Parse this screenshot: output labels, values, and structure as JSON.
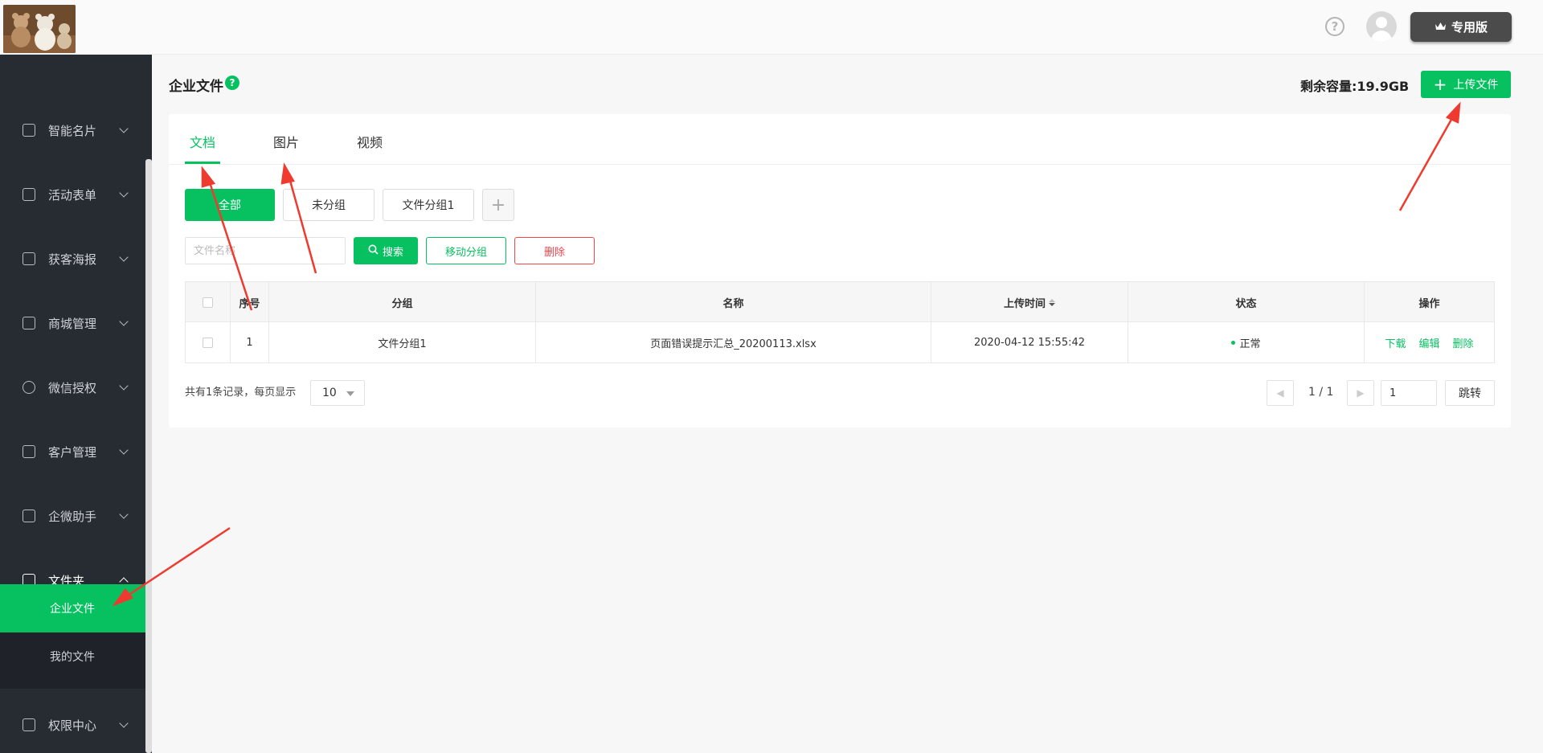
{
  "header": {
    "help_icon": "question-circle-icon",
    "avatar_icon": "user-avatar-icon",
    "edition_label": "专用版",
    "crown_icon": "crown-icon"
  },
  "sidebar": {
    "items": [
      {
        "label": "智能名片",
        "icon": "id-card-icon"
      },
      {
        "label": "活动表单",
        "icon": "clipboard-icon"
      },
      {
        "label": "获客海报",
        "icon": "store-icon"
      },
      {
        "label": "商城管理",
        "icon": "shop-icon"
      },
      {
        "label": "微信授权",
        "icon": "wechat-icon"
      },
      {
        "label": "客户管理",
        "icon": "customer-icon"
      },
      {
        "label": "企微助手",
        "icon": "lock-icon"
      },
      {
        "label": "文件夹",
        "icon": "folder-icon"
      },
      {
        "label": "权限中心",
        "icon": "lock-icon"
      }
    ],
    "sub_items": [
      {
        "label": "企业文件"
      },
      {
        "label": "我的文件"
      }
    ]
  },
  "page": {
    "title": "企业文件",
    "help_mark": "?",
    "capacity": "剩余容量:19.9GB",
    "upload_label": "上传文件"
  },
  "tabs": [
    "文档",
    "图片",
    "视频"
  ],
  "groups": [
    "全部",
    "未分组",
    "文件分组1"
  ],
  "add_group": "+",
  "search": {
    "placeholder": "文件名称",
    "search_label": "搜索",
    "move_label": "移动分组",
    "delete_label": "删除"
  },
  "table": {
    "headers": [
      "序号",
      "分组",
      "名称",
      "上传时间",
      "状态",
      "操作"
    ],
    "rows": [
      {
        "index": "1",
        "group": "文件分组1",
        "name": "页面错误提示汇总_20200113.xlsx",
        "time": "2020-04-12 15:55:42",
        "status": "正常",
        "actions": [
          "下载",
          "编辑",
          "删除"
        ]
      }
    ]
  },
  "pagination": {
    "summary": "共有1条记录，每页显示",
    "page_size": "10",
    "page_info": "1 / 1",
    "jump_value": "1",
    "jump_label": "跳转"
  },
  "annotations": {
    "arrow_color": "#ee3a2f"
  },
  "colors": {
    "accent": "#07c160",
    "sidebar_bg": "#272c33",
    "danger": "#f5454a"
  }
}
